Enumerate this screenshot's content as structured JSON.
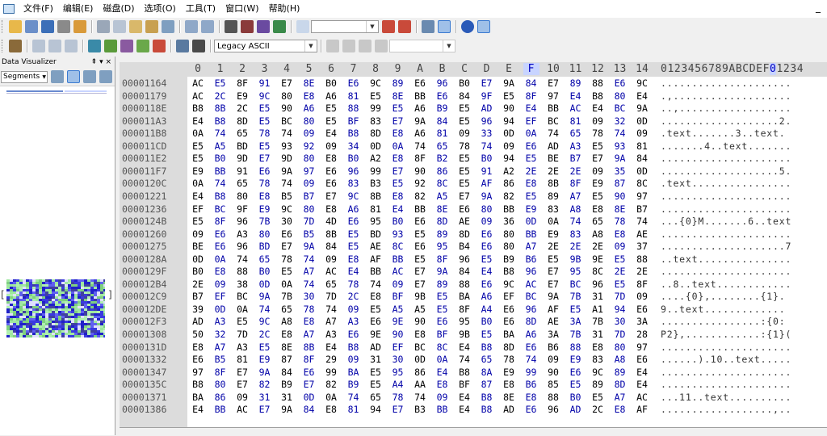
{
  "menu": {
    "items": [
      "文件(F)",
      "编辑(E)",
      "磁盘(D)",
      "选项(O)",
      "工具(T)",
      "窗口(W)",
      "帮助(H)"
    ],
    "minimize": "_"
  },
  "toolbar2": {
    "charset_value": "Legacy ASCII"
  },
  "left_panel": {
    "title": "Data Visualizer",
    "pin": "⇞ ▾ ×",
    "mode_value": "Segments"
  },
  "hex": {
    "column_headers": [
      "0",
      "1",
      "2",
      "3",
      "4",
      "5",
      "6",
      "7",
      "8",
      "9",
      "A",
      "B",
      "C",
      "D",
      "E",
      "F",
      "10",
      "11",
      "12",
      "13",
      "14"
    ],
    "ascii_header": "0123456789ABCDEF01234",
    "ascii_header_highlight_index": 16,
    "highlight_column_index": 15,
    "rows": [
      {
        "offset": "00001164",
        "bytes": [
          "AC",
          "E5",
          "8F",
          "91",
          "E7",
          "8E",
          "B0",
          "E6",
          "9C",
          "89",
          "E6",
          "96",
          "B0",
          "E7",
          "9A",
          "84",
          "E7",
          "89",
          "88",
          "E6",
          "9C"
        ],
        "ascii": "....................."
      },
      {
        "offset": "00001179",
        "bytes": [
          "AC",
          "2C",
          "E9",
          "9C",
          "80",
          "E8",
          "A6",
          "81",
          "E5",
          "8E",
          "BB",
          "E6",
          "84",
          "9F",
          "E5",
          "8F",
          "97",
          "E4",
          "B8",
          "80",
          "E4"
        ],
        "ascii": ".,..................."
      },
      {
        "offset": "0000118E",
        "bytes": [
          "B8",
          "8B",
          "2C",
          "E5",
          "90",
          "A6",
          "E5",
          "88",
          "99",
          "E5",
          "A6",
          "B9",
          "E5",
          "AD",
          "90",
          "E4",
          "BB",
          "AC",
          "E4",
          "BC",
          "9A"
        ],
        "ascii": "..,.................."
      },
      {
        "offset": "000011A3",
        "bytes": [
          "E4",
          "B8",
          "8D",
          "E5",
          "BC",
          "80",
          "E5",
          "BF",
          "83",
          "E7",
          "9A",
          "84",
          "E5",
          "96",
          "94",
          "EF",
          "BC",
          "81",
          "09",
          "32",
          "0D"
        ],
        "ascii": "...................2."
      },
      {
        "offset": "000011B8",
        "bytes": [
          "0A",
          "74",
          "65",
          "78",
          "74",
          "09",
          "E4",
          "B8",
          "8D",
          "E8",
          "A6",
          "81",
          "09",
          "33",
          "0D",
          "0A",
          "74",
          "65",
          "78",
          "74",
          "09"
        ],
        "ascii": ".text.......3..text."
      },
      {
        "offset": "000011CD",
        "bytes": [
          "E5",
          "A5",
          "BD",
          "E5",
          "93",
          "92",
          "09",
          "34",
          "0D",
          "0A",
          "74",
          "65",
          "78",
          "74",
          "09",
          "E6",
          "AD",
          "A3",
          "E5",
          "93",
          "81"
        ],
        "ascii": ".......4..text......."
      },
      {
        "offset": "000011E2",
        "bytes": [
          "E5",
          "B0",
          "9D",
          "E7",
          "9D",
          "80",
          "E8",
          "B0",
          "A2",
          "E8",
          "8F",
          "B2",
          "E5",
          "B0",
          "94",
          "E5",
          "BE",
          "B7",
          "E7",
          "9A",
          "84"
        ],
        "ascii": "....................."
      },
      {
        "offset": "000011F7",
        "bytes": [
          "E9",
          "BB",
          "91",
          "E6",
          "9A",
          "97",
          "E6",
          "96",
          "99",
          "E7",
          "90",
          "86",
          "E5",
          "91",
          "A2",
          "2E",
          "2E",
          "2E",
          "09",
          "35",
          "0D"
        ],
        "ascii": "...................5."
      },
      {
        "offset": "0000120C",
        "bytes": [
          "0A",
          "74",
          "65",
          "78",
          "74",
          "09",
          "E6",
          "83",
          "B3",
          "E5",
          "92",
          "8C",
          "E5",
          "AF",
          "86",
          "E8",
          "8B",
          "8F",
          "E9",
          "87",
          "8C"
        ],
        "ascii": ".text................"
      },
      {
        "offset": "00001221",
        "bytes": [
          "E4",
          "B8",
          "80",
          "E8",
          "B5",
          "B7",
          "E7",
          "9C",
          "8B",
          "E8",
          "82",
          "A5",
          "E7",
          "9A",
          "82",
          "E5",
          "89",
          "A7",
          "E5",
          "90",
          "97"
        ],
        "ascii": "....................."
      },
      {
        "offset": "00001236",
        "bytes": [
          "EF",
          "BC",
          "9F",
          "E9",
          "9C",
          "80",
          "E8",
          "A6",
          "81",
          "E4",
          "BB",
          "8E",
          "E6",
          "80",
          "BB",
          "E9",
          "83",
          "A8",
          "E8",
          "8E",
          "B7"
        ],
        "ascii": "....................."
      },
      {
        "offset": "0000124B",
        "bytes": [
          "E5",
          "8F",
          "96",
          "7B",
          "30",
          "7D",
          "4D",
          "E6",
          "95",
          "B0",
          "E6",
          "8D",
          "AE",
          "09",
          "36",
          "0D",
          "0A",
          "74",
          "65",
          "78",
          "74"
        ],
        "ascii": "...{0}M.......6..text"
      },
      {
        "offset": "00001260",
        "bytes": [
          "09",
          "E6",
          "A3",
          "80",
          "E6",
          "B5",
          "8B",
          "E5",
          "BD",
          "93",
          "E5",
          "89",
          "8D",
          "E6",
          "80",
          "BB",
          "E9",
          "83",
          "A8",
          "E8",
          "AE"
        ],
        "ascii": "....................."
      },
      {
        "offset": "00001275",
        "bytes": [
          "BE",
          "E6",
          "96",
          "BD",
          "E7",
          "9A",
          "84",
          "E5",
          "AE",
          "8C",
          "E6",
          "95",
          "B4",
          "E6",
          "80",
          "A7",
          "2E",
          "2E",
          "2E",
          "09",
          "37"
        ],
        "ascii": "....................7"
      },
      {
        "offset": "0000128A",
        "bytes": [
          "0D",
          "0A",
          "74",
          "65",
          "78",
          "74",
          "09",
          "E8",
          "AF",
          "BB",
          "E5",
          "8F",
          "96",
          "E5",
          "B9",
          "B6",
          "E5",
          "9B",
          "9E",
          "E5",
          "88"
        ],
        "ascii": "..text..............."
      },
      {
        "offset": "0000129F",
        "bytes": [
          "B0",
          "E8",
          "88",
          "B0",
          "E5",
          "A7",
          "AC",
          "E4",
          "BB",
          "AC",
          "E7",
          "9A",
          "84",
          "E4",
          "B8",
          "96",
          "E7",
          "95",
          "8C",
          "2E",
          "2E"
        ],
        "ascii": "....................."
      },
      {
        "offset": "000012B4",
        "bytes": [
          "2E",
          "09",
          "38",
          "0D",
          "0A",
          "74",
          "65",
          "78",
          "74",
          "09",
          "E7",
          "89",
          "88",
          "E6",
          "9C",
          "AC",
          "E7",
          "BC",
          "96",
          "E5",
          "8F"
        ],
        "ascii": "..8..text............"
      },
      {
        "offset": "000012C9",
        "bytes": [
          "B7",
          "EF",
          "BC",
          "9A",
          "7B",
          "30",
          "7D",
          "2C",
          "E8",
          "BF",
          "9B",
          "E5",
          "BA",
          "A6",
          "EF",
          "BC",
          "9A",
          "7B",
          "31",
          "7D",
          "09"
        ],
        "ascii": "....{0},........{1}."
      },
      {
        "offset": "000012DE",
        "bytes": [
          "39",
          "0D",
          "0A",
          "74",
          "65",
          "78",
          "74",
          "09",
          "E5",
          "A5",
          "A5",
          "E5",
          "8F",
          "A4",
          "E6",
          "96",
          "AF",
          "E5",
          "A1",
          "94",
          "E6"
        ],
        "ascii": "9..text............."
      },
      {
        "offset": "000012F3",
        "bytes": [
          "AD",
          "A3",
          "E5",
          "9C",
          "A8",
          "E8",
          "A7",
          "A3",
          "E6",
          "9E",
          "90",
          "E6",
          "95",
          "B0",
          "E6",
          "8D",
          "AE",
          "3A",
          "7B",
          "30",
          "3A"
        ],
        "ascii": "................:{0:"
      },
      {
        "offset": "00001308",
        "bytes": [
          "50",
          "32",
          "7D",
          "2C",
          "E8",
          "A7",
          "A3",
          "E6",
          "9E",
          "90",
          "E8",
          "BF",
          "9B",
          "E5",
          "BA",
          "A6",
          "3A",
          "7B",
          "31",
          "7D",
          "28"
        ],
        "ascii": "P2},............:{1}("
      },
      {
        "offset": "0000131D",
        "bytes": [
          "E8",
          "A7",
          "A3",
          "E5",
          "8E",
          "8B",
          "E4",
          "B8",
          "AD",
          "EF",
          "BC",
          "8C",
          "E4",
          "B8",
          "8D",
          "E6",
          "B6",
          "88",
          "E8",
          "80",
          "97"
        ],
        "ascii": "....................."
      },
      {
        "offset": "00001332",
        "bytes": [
          "E6",
          "B5",
          "81",
          "E9",
          "87",
          "8F",
          "29",
          "09",
          "31",
          "30",
          "0D",
          "0A",
          "74",
          "65",
          "78",
          "74",
          "09",
          "E9",
          "83",
          "A8",
          "E6"
        ],
        "ascii": "......).10..text....."
      },
      {
        "offset": "00001347",
        "bytes": [
          "97",
          "8F",
          "E7",
          "9A",
          "84",
          "E6",
          "99",
          "BA",
          "E5",
          "95",
          "86",
          "E4",
          "B8",
          "8A",
          "E9",
          "99",
          "90",
          "E6",
          "9C",
          "89",
          "E4"
        ],
        "ascii": "....................."
      },
      {
        "offset": "0000135C",
        "bytes": [
          "B8",
          "80",
          "E7",
          "82",
          "B9",
          "E7",
          "82",
          "B9",
          "E5",
          "A4",
          "AA",
          "E8",
          "BF",
          "87",
          "E8",
          "B6",
          "85",
          "E5",
          "89",
          "8D",
          "E4"
        ],
        "ascii": "....................."
      },
      {
        "offset": "00001371",
        "bytes": [
          "BA",
          "86",
          "09",
          "31",
          "31",
          "0D",
          "0A",
          "74",
          "65",
          "78",
          "74",
          "09",
          "E4",
          "B8",
          "8E",
          "E8",
          "88",
          "B0",
          "E5",
          "A7",
          "AC"
        ],
        "ascii": "...11..text.........."
      },
      {
        "offset": "00001386",
        "bytes": [
          "E4",
          "BB",
          "AC",
          "E7",
          "9A",
          "84",
          "E8",
          "81",
          "94",
          "E7",
          "B3",
          "BB",
          "E4",
          "B8",
          "AD",
          "E6",
          "96",
          "AD",
          "2C",
          "E8",
          "AF"
        ],
        "ascii": "..................,.."
      }
    ]
  },
  "colors": {
    "highlight_bg": "#c8d4ff",
    "highlight_fg": "#0000c0",
    "header_bg": "#dcdcdc"
  }
}
